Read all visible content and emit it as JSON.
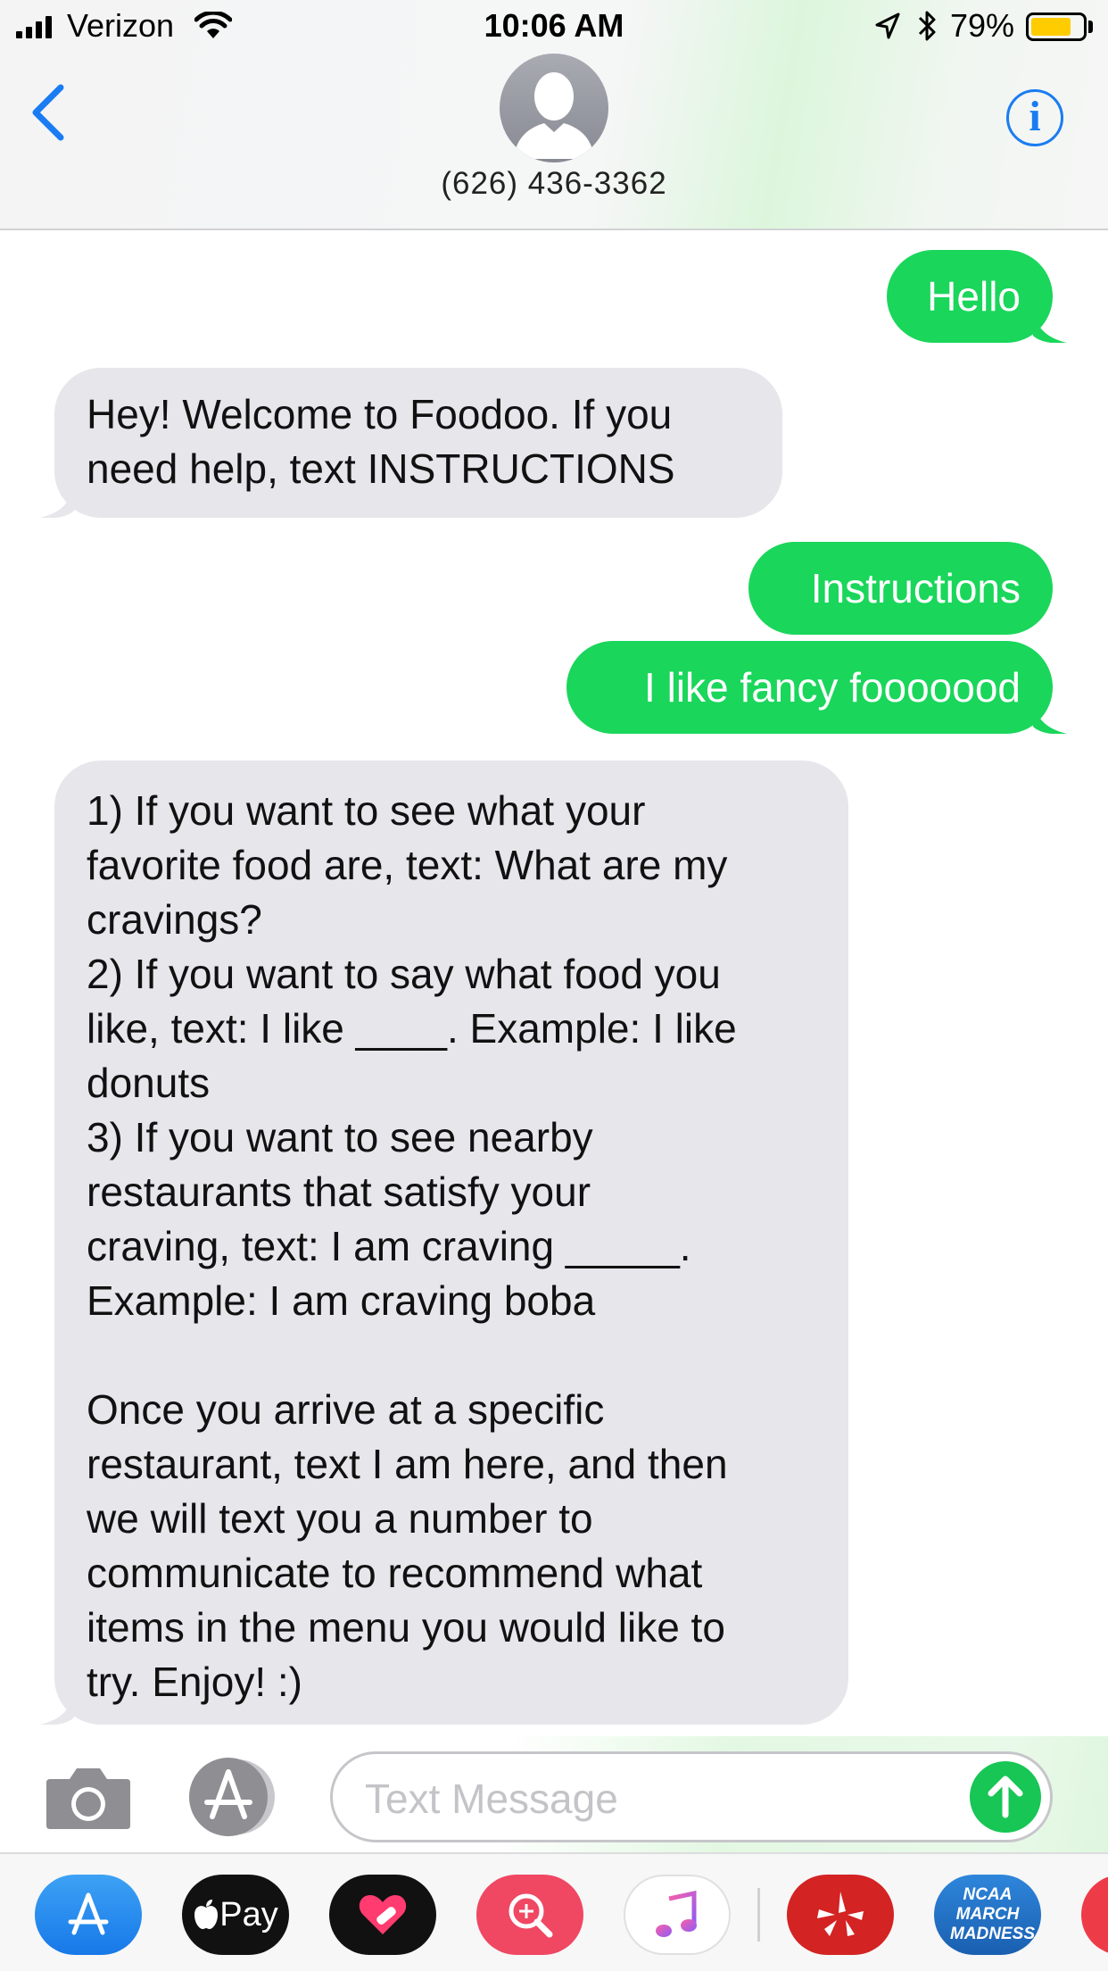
{
  "status_bar": {
    "carrier": "Verizon",
    "time": "10:06 AM",
    "battery_percent": "79%",
    "battery_level": 0.79,
    "battery_color": "#ffcc00"
  },
  "nav": {
    "contact": "(626) 436-3362",
    "info_glyph": "i"
  },
  "messages": [
    {
      "from": "me",
      "text": "Hello"
    },
    {
      "from": "them",
      "text": "Hey! Welcome to Foodoo. If you\nneed help, text INSTRUCTIONS"
    },
    {
      "from": "me",
      "text": "Instructions"
    },
    {
      "from": "me",
      "text": "I like fancy fooooood"
    },
    {
      "from": "them",
      "text": "1) If you want to see what your\nfavorite food are, text: What are my\ncravings?\n2) If you want to say what food you\nlike, text: I like ____. Example: I like\ndonuts\n3) If you want to see nearby\nrestaurants that satisfy your\ncraving, text: I am craving _____.\nExample: I am craving boba\n\nOnce you arrive at a specific\nrestaurant, text I am here, and then\nwe will text you a number to\ncommunicate to recommend what\nitems in the menu you would like to\ntry. Enjoy! :)"
    }
  ],
  "composer": {
    "placeholder": "Text Message",
    "value": ""
  },
  "app_drawer": {
    "apps": [
      "app-store-icon",
      "apple-pay-icon",
      "digital-touch-icon",
      "image-search-icon",
      "music-icon",
      "yelp-icon",
      "ncaa-march-madness-icon"
    ],
    "pay_label": "Pay",
    "ncaa_label": "NCAA MARCH MADNESS"
  },
  "colors": {
    "outgoing_bubble": "#1ad65b",
    "incoming_bubble": "#e6e6eb",
    "accent_blue": "#1a7cf2",
    "send_button": "#17c654"
  }
}
